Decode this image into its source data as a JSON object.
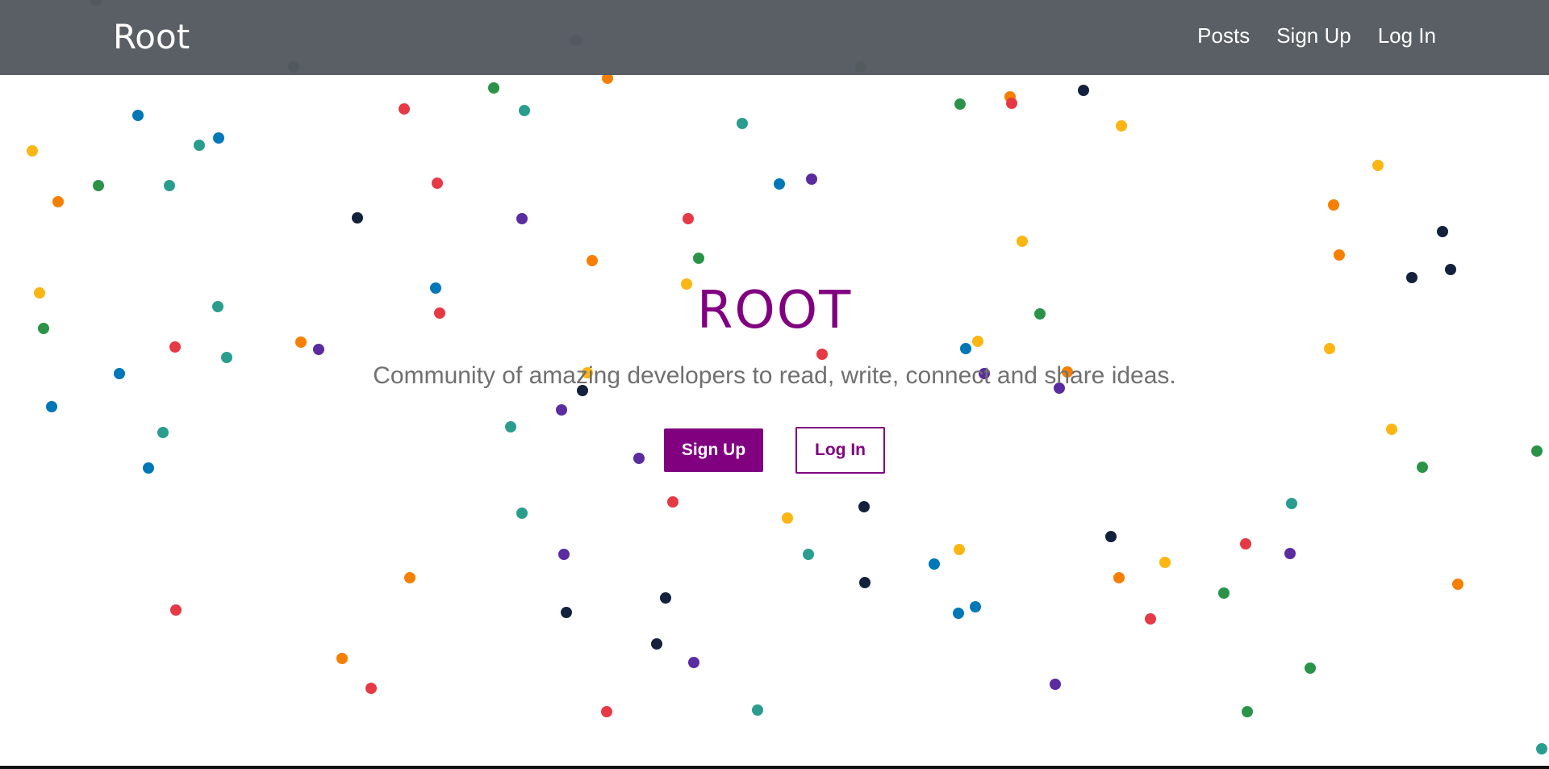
{
  "navbar": {
    "brand": "Root",
    "links": [
      {
        "label": "Posts"
      },
      {
        "label": "Sign Up"
      },
      {
        "label": "Log In"
      }
    ]
  },
  "hero": {
    "title": "ROOT",
    "subtitle": "Community of amazing developers to read, write, connect and share ideas.",
    "signup_label": "Sign Up",
    "login_label": "Log In"
  },
  "colors": {
    "accent": "#800080",
    "navbar_bg": "#545a5f",
    "dot_palette": [
      "#e63946",
      "#0077b6",
      "#2a9d8f",
      "#2b9348",
      "#fbb614",
      "#f77f00",
      "#5a2ca0",
      "#14213d"
    ]
  },
  "background": {
    "icon": "confetti-dots"
  }
}
